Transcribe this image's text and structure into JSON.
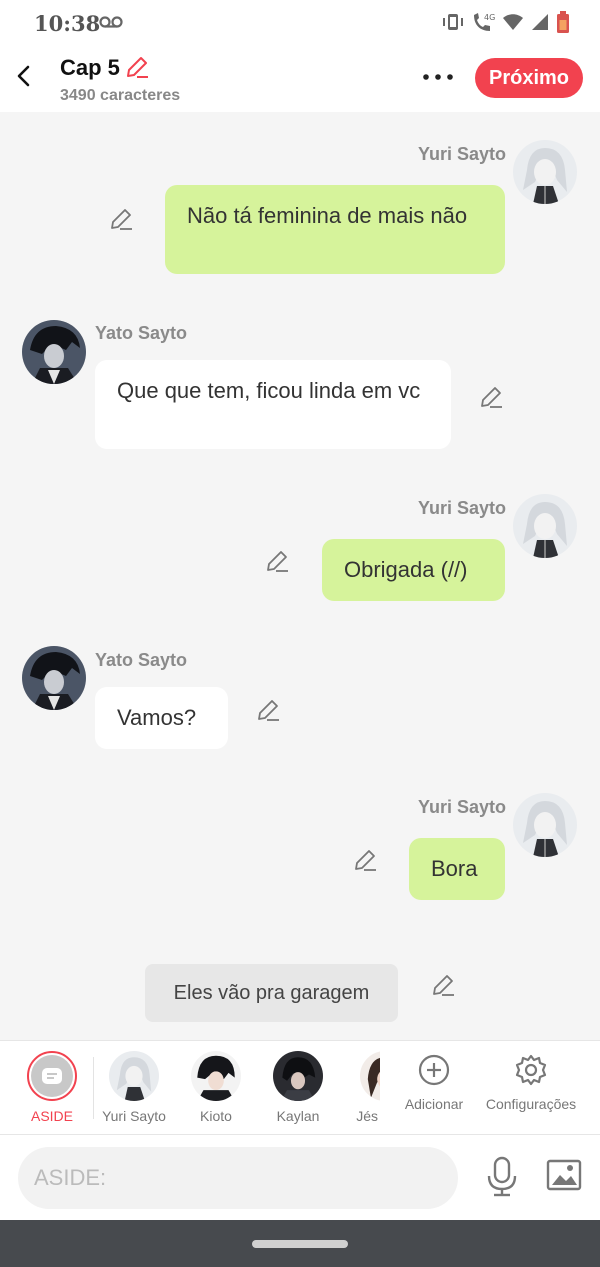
{
  "status": {
    "time": "10:38",
    "network": "4G"
  },
  "header": {
    "title": "Cap 5",
    "subtitle": "3490 caracteres",
    "next_label": "Próximo"
  },
  "messages": [
    {
      "sender": "Yuri Sayto",
      "side": "right",
      "text": "Não tá feminina de mais não"
    },
    {
      "sender": "Yato Sayto",
      "side": "left",
      "text": "Que que tem, ficou linda em vc"
    },
    {
      "sender": "Yuri Sayto",
      "side": "right",
      "text": "Obrigada (//)"
    },
    {
      "sender": "Yato Sayto",
      "side": "left",
      "text": "Vamos?"
    },
    {
      "sender": "Yuri Sayto",
      "side": "right",
      "text": "Bora"
    }
  ],
  "aside_message": "Eles vão pra garagem",
  "characters": [
    {
      "label": "ASIDE",
      "selected": true
    },
    {
      "label": "Yuri Sayto"
    },
    {
      "label": "Kioto"
    },
    {
      "label": "Kaylan"
    },
    {
      "label": "Jés"
    }
  ],
  "tools": {
    "add_label": "Adicionar",
    "settings_label": "Configurações"
  },
  "input": {
    "placeholder": "ASIDE:"
  },
  "colors": {
    "accent": "#f2424f",
    "right_bubble": "#d6f39b",
    "left_bubble": "#ffffff",
    "background": "#f5f5f5"
  }
}
